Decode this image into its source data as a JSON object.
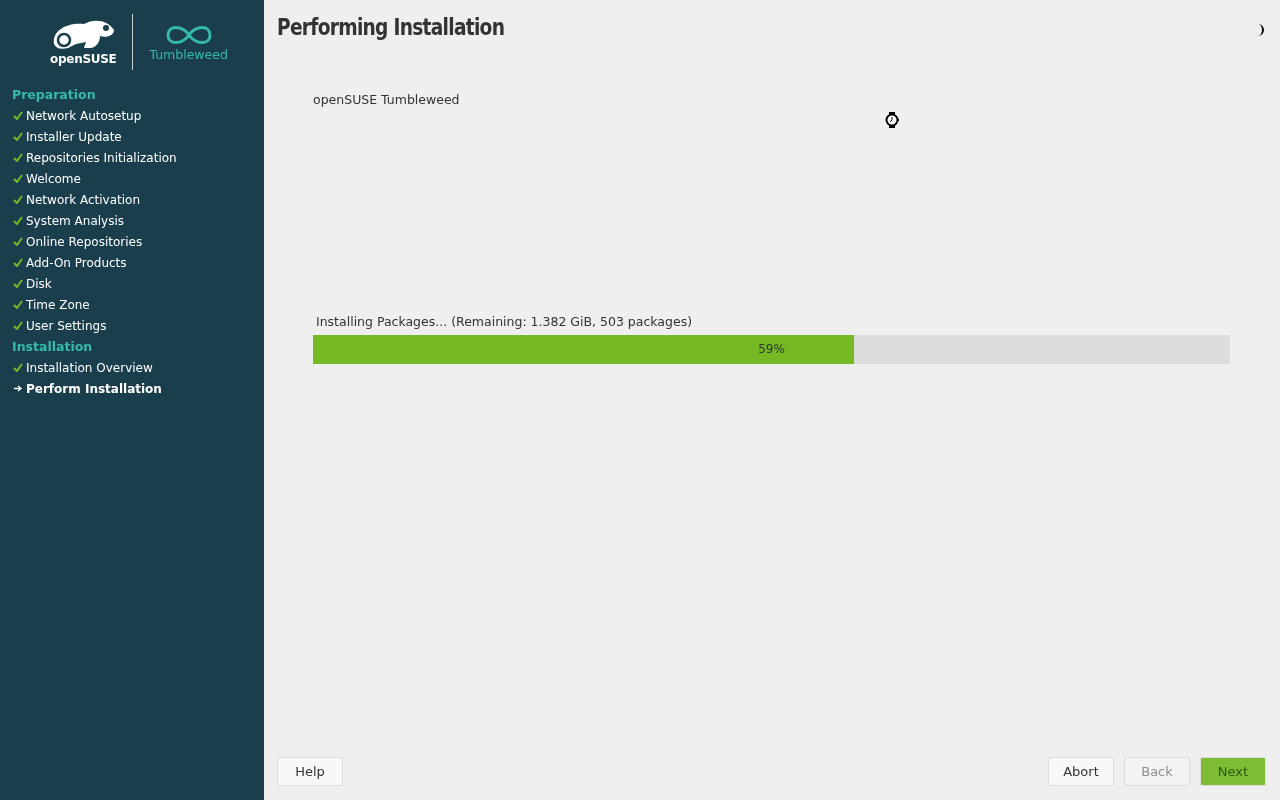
{
  "logo": {
    "brand": "openSUSE",
    "product": "Tumbleweed"
  },
  "sidebar": {
    "sections": [
      {
        "title": "Preparation",
        "items": [
          {
            "label": "Network Autosetup",
            "kind": "done"
          },
          {
            "label": "Installer Update",
            "kind": "done"
          },
          {
            "label": "Repositories Initialization",
            "kind": "done"
          },
          {
            "label": "Welcome",
            "kind": "done"
          },
          {
            "label": "Network Activation",
            "kind": "done"
          },
          {
            "label": "System Analysis",
            "kind": "done"
          },
          {
            "label": "Online Repositories",
            "kind": "done"
          },
          {
            "label": "Add-On Products",
            "kind": "done"
          },
          {
            "label": "Disk",
            "kind": "done"
          },
          {
            "label": "Time Zone",
            "kind": "done"
          },
          {
            "label": "User Settings",
            "kind": "done"
          }
        ]
      },
      {
        "title": "Installation",
        "items": [
          {
            "label": "Installation Overview",
            "kind": "done"
          },
          {
            "label": "Perform Installation",
            "kind": "current"
          }
        ]
      }
    ]
  },
  "title": "Performing Installation",
  "product_name": "openSUSE Tumbleweed",
  "progress": {
    "label": "Installing Packages... (Remaining: 1.382 GiB, 503 packages)",
    "level": 0.59,
    "reading": "59%"
  },
  "buttons": [
    {
      "label": "Help",
      "disabled": false,
      "primary": false
    },
    {
      "label": "Abort",
      "disabled": false,
      "primary": false
    },
    {
      "label": "Back",
      "disabled": true,
      "primary": false
    },
    {
      "label": "Next",
      "disabled": true,
      "primary": true
    }
  ]
}
